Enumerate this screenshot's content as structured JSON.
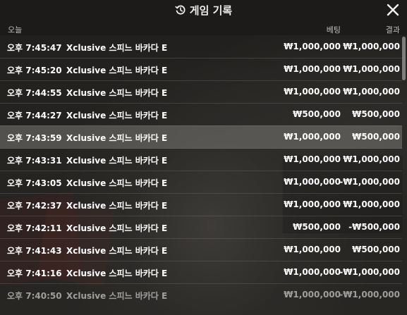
{
  "header": {
    "title": "게임 기록",
    "icon": "history-icon",
    "close_icon": "close-icon"
  },
  "columns": {
    "today": "오늘",
    "bet": "베팅",
    "result": "결과"
  },
  "rows": [
    {
      "time": "오후 7:45:47",
      "game": "Xclusive 스피느 바카다 E",
      "bet": "₩1,000,000",
      "result": "₩1,000,000"
    },
    {
      "time": "오후 7:45:20",
      "game": "Xclusive 스피느 바카다 E",
      "bet": "₩1,000,000",
      "result": "₩1,000,000"
    },
    {
      "time": "오후 7:44:55",
      "game": "Xclusive 스피느 바카다 E",
      "bet": "₩1,000,000",
      "result": "₩1,000,000"
    },
    {
      "time": "오후 7:44:27",
      "game": "Xclusive 스피느 바카다 E",
      "bet": "₩500,000",
      "result": "₩500,000"
    },
    {
      "time": "오후 7:43:59",
      "game": "Xclusive 스피느 바카다 E",
      "bet": "₩1,000,000",
      "result": "₩500,000"
    },
    {
      "time": "오후 7:43:31",
      "game": "Xclusive 스피느 바카다 E",
      "bet": "₩1,000,000",
      "result": "₩1,000,000"
    },
    {
      "time": "오후 7:43:05",
      "game": "Xclusive 스피느 바카다 E",
      "bet": "₩1,000,000",
      "result": "-₩1,000,000"
    },
    {
      "time": "오후 7:42:37",
      "game": "Xclusive 스피느 바카다 E",
      "bet": "₩1,000,000",
      "result": "₩1,000,000"
    },
    {
      "time": "오후 7:42:11",
      "game": "Xclusive 스피느 바카다 E",
      "bet": "₩500,000",
      "result": "-₩500,000"
    },
    {
      "time": "오후 7:41:43",
      "game": "Xclusive 스피느 바카다 E",
      "bet": "₩1,000,000",
      "result": "₩500,000"
    },
    {
      "time": "오후 7:41:16",
      "game": "Xclusive 스피느 바카다 E",
      "bet": "₩1,000,000",
      "result": "-₩1,000,000"
    },
    {
      "time": "오후 7:40:50",
      "game": "Xclusive 스피느 바카다 E",
      "bet": "₩1,000,000",
      "result": "-₩1,000,000"
    }
  ],
  "highlighted_row": 4,
  "colors": {
    "text": "#ffffff",
    "header_bg": "#1c1b19",
    "row_highlight": "#8c8a84"
  }
}
